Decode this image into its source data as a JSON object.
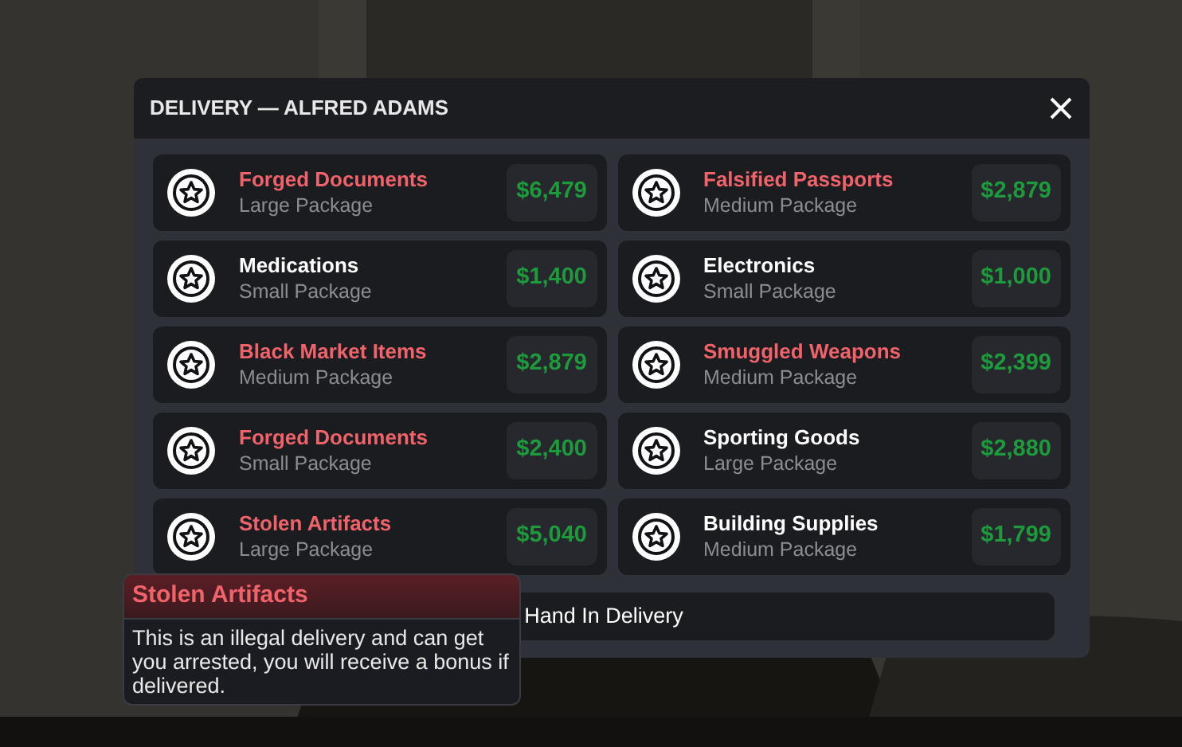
{
  "window": {
    "title": "DELIVERY — ALFRED ADAMS"
  },
  "deliveries": [
    {
      "name": "Forged Documents",
      "size": "Large Package",
      "price": "$6,479",
      "illegal": true
    },
    {
      "name": "Falsified Passports",
      "size": "Medium Package",
      "price": "$2,879",
      "illegal": true
    },
    {
      "name": "Medications",
      "size": "Small Package",
      "price": "$1,400",
      "illegal": false
    },
    {
      "name": "Electronics",
      "size": "Small Package",
      "price": "$1,000",
      "illegal": false
    },
    {
      "name": "Black Market Items",
      "size": "Medium Package",
      "price": "$2,879",
      "illegal": true
    },
    {
      "name": "Smuggled Weapons",
      "size": "Medium Package",
      "price": "$2,399",
      "illegal": true
    },
    {
      "name": "Forged Documents",
      "size": "Small Package",
      "price": "$2,400",
      "illegal": true
    },
    {
      "name": "Sporting Goods",
      "size": "Large Package",
      "price": "$2,880",
      "illegal": false
    },
    {
      "name": "Stolen Artifacts",
      "size": "Large Package",
      "price": "$5,040",
      "illegal": true
    },
    {
      "name": "Building Supplies",
      "size": "Medium Package",
      "price": "$1,799",
      "illegal": false
    }
  ],
  "hand_in_button": "Hand In Delivery",
  "tooltip": {
    "title": "Stolen Artifacts",
    "text": "This is an illegal delivery and can get you arrested, you will receive a bonus if delivered."
  }
}
